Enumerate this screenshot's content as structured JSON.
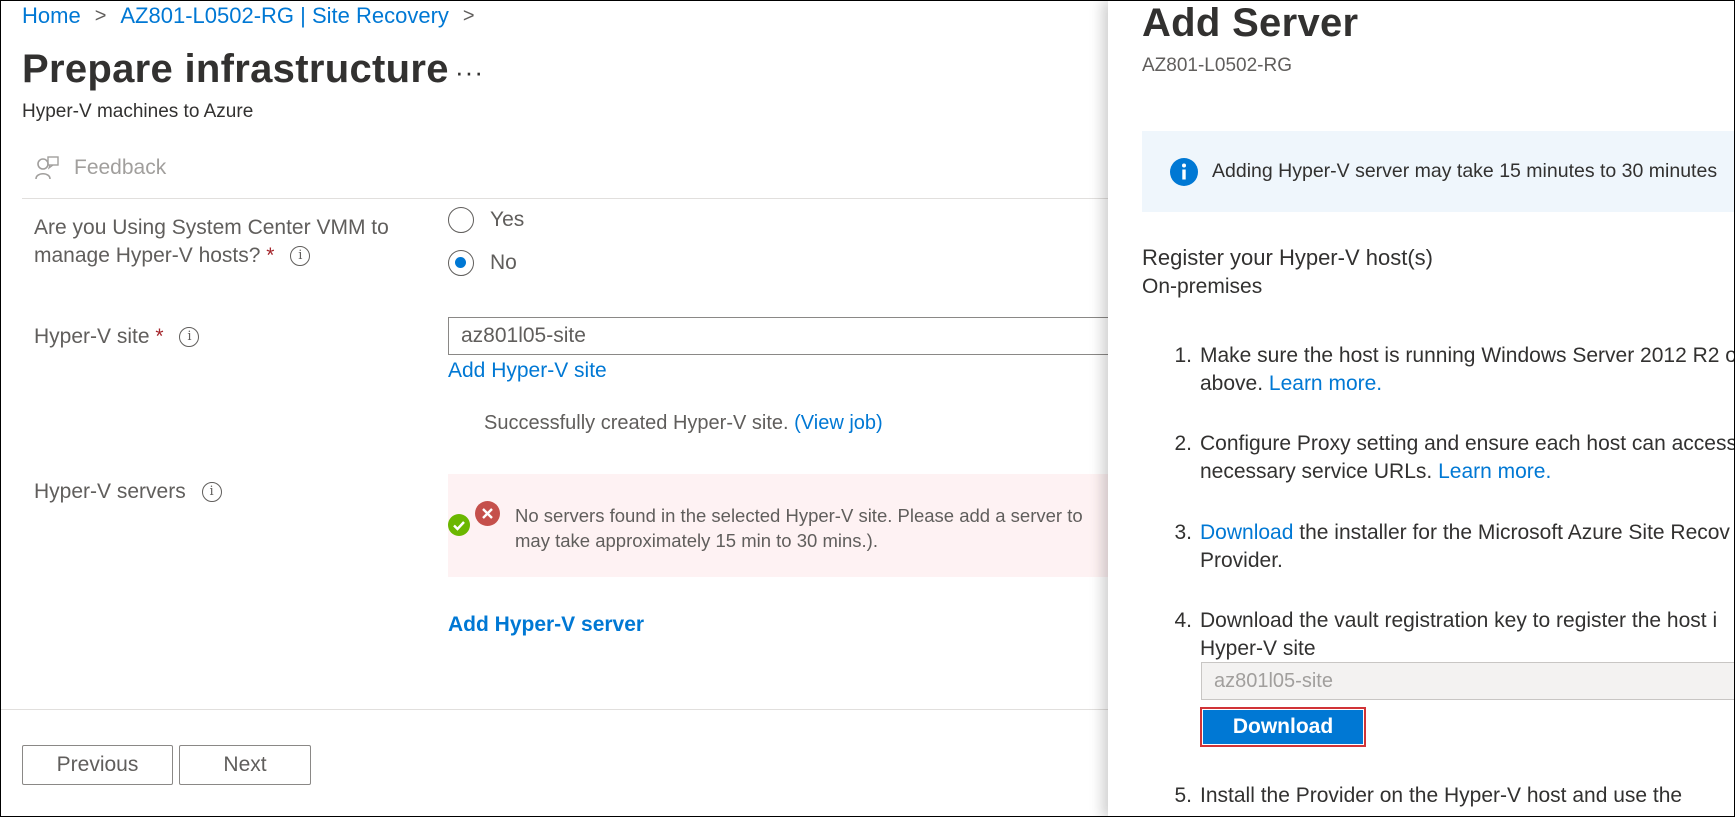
{
  "breadcrumb": {
    "home": "Home",
    "sep1": ">",
    "resource": "AZ801-L0502-RG | Site Recovery",
    "sep2": ">"
  },
  "page": {
    "title": "Prepare infrastructure",
    "more": "···",
    "subtitle": "Hyper-V machines to Azure"
  },
  "toolbar": {
    "feedback": "Feedback",
    "feedback_icon": "feedback-icon"
  },
  "form": {
    "vmm_question_line1": "Are you Using System Center VMM to",
    "vmm_question_line2": "manage Hyper-V hosts?",
    "required_mark": "*",
    "info_glyph": "i",
    "options": {
      "yes": "Yes",
      "no": "No"
    },
    "selected_option": "No",
    "site_label": "Hyper-V site",
    "site_value": "az801l05-site",
    "add_site_link": "Add Hyper-V site",
    "success_text": "Successfully created Hyper-V site.",
    "view_job_link": "(View job)",
    "servers_label": "Hyper-V servers",
    "error_line1": "No servers found in the selected Hyper-V site. Please add a server to",
    "error_line2": "may take approximately 15 min to 30 mins.).",
    "add_server_link": "Add Hyper-V server"
  },
  "footer": {
    "previous": "Previous",
    "next": "Next"
  },
  "panel": {
    "title": "Add Server",
    "subtitle": "AZ801-L0502-RG",
    "info_banner": "Adding Hyper-V server may take 15 minutes to 30 minutes",
    "register_title": "Register your Hyper-V host(s)",
    "register_sub": "On-premises",
    "steps": [
      {
        "num": "1.",
        "line1": "Make sure the host is running Windows Server 2012 R2 o",
        "line2": "above.",
        "link": "Learn more."
      },
      {
        "num": "2.",
        "line1": "Configure Proxy setting and ensure each host can access",
        "line2": "necessary service URLs.",
        "link": "Learn more."
      },
      {
        "num": "3.",
        "link": "Download",
        "line1": "the installer for the Microsoft Azure Site Recov",
        "line2": "Provider."
      },
      {
        "num": "4.",
        "line1": "Download the vault registration key to register the host i",
        "line2": "Hyper-V site"
      },
      {
        "num": "5.",
        "line1": "Install the Provider on the Hyper-V host and use the"
      }
    ],
    "key_site_value": "az801l05-site",
    "download_button": "Download"
  },
  "colors": {
    "accent": "#0078d4",
    "error_bg": "#fde7e9",
    "info_bg": "#eff6fc",
    "required": "#a4262c",
    "highlight_border": "#d13438"
  }
}
